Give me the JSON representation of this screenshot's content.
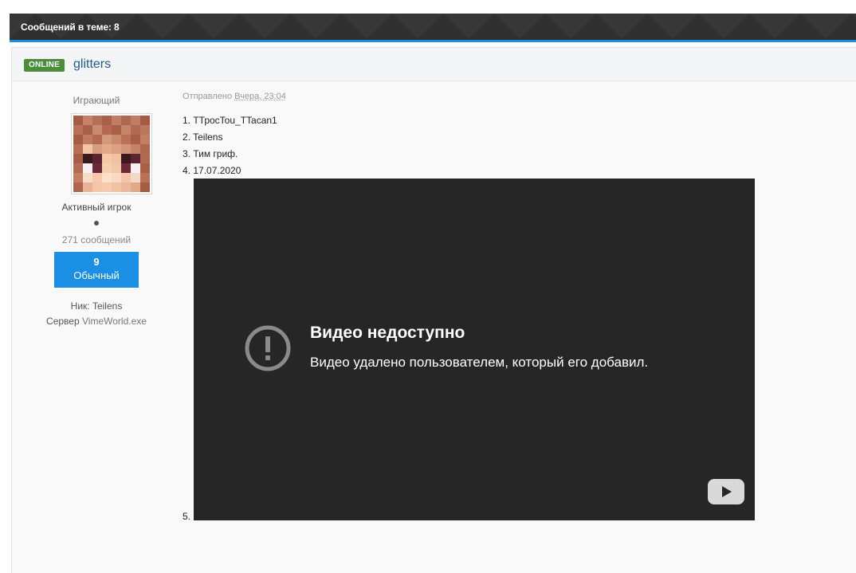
{
  "topic_bar": {
    "title": "Сообщений в теме: 8"
  },
  "post": {
    "status_badge": "ONLINE",
    "author": "glitters",
    "user_title": "Играющий",
    "group": "Активный игрок",
    "post_count": "271 сообщений",
    "reputation": {
      "value": "9",
      "label": "Обычный"
    },
    "nick_line": "Ник: Teilens",
    "server_label": "Сервер",
    "server_name": "VimeWorld.exe",
    "posted_prefix": "Отправлено",
    "posted_date": "Вчера, 23:04",
    "lines": [
      "1. ТТросTou_TTacan1",
      "2. Teilens",
      "3. Тим гриф.",
      "4. 17.07.2020"
    ],
    "last_item": "5.",
    "video": {
      "title": "Видео недоступно",
      "message": "Видео удалено пользователем, который его добавил.",
      "alert_icon": "exclamation-circle-icon",
      "logo_icon": "youtube-logo-icon"
    }
  },
  "colors": {
    "accent_blue": "#1a8fe3",
    "online_green": "#4c8d3c",
    "author_link": "#1f5a8a",
    "video_bg": "#262626"
  }
}
